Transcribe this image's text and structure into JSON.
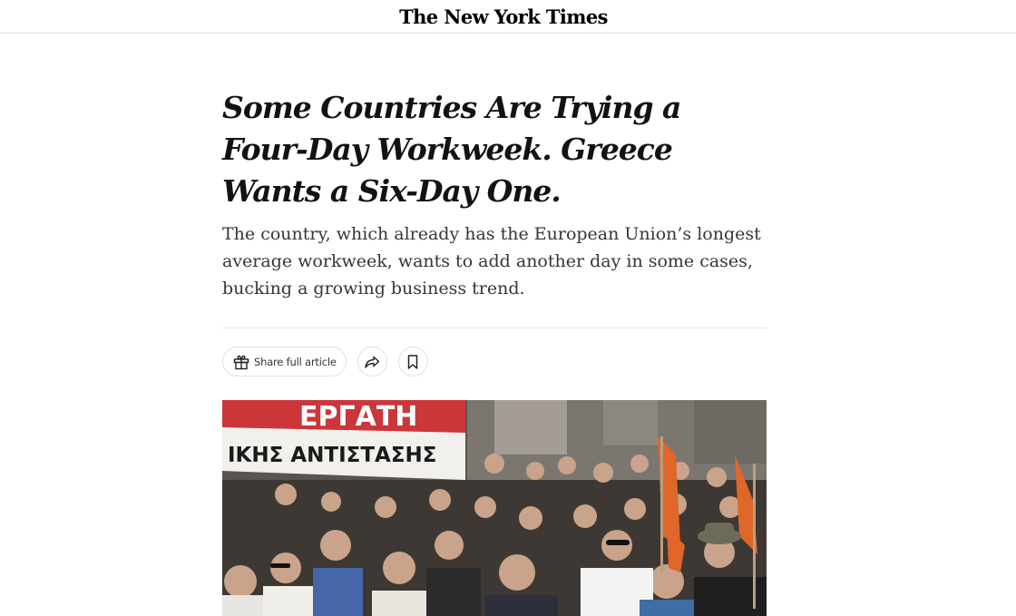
{
  "masthead": {
    "logo_text": "The New York Times"
  },
  "article": {
    "headline": "Some Countries Are Trying a Four-Day Workweek. Greece Wants a Six-Day One.",
    "summary": "The country, which already has the European Union’s longest average workweek, wants to add another day in some cases, bucking a growing business trend."
  },
  "actions": {
    "share_full_label": "Share full article",
    "gift_icon": "gift-icon",
    "share_icon": "share-arrow-icon",
    "bookmark_icon": "bookmark-icon"
  },
  "photo": {
    "banner_line1": "ΕΡΓΑΤΗ",
    "banner_line2": "ΙΚΗΣ ΑΝΤΙΣΤΑΣΗΣ",
    "colors": {
      "banner_red": "#c8262a",
      "flag_orange": "#e0662a"
    }
  }
}
